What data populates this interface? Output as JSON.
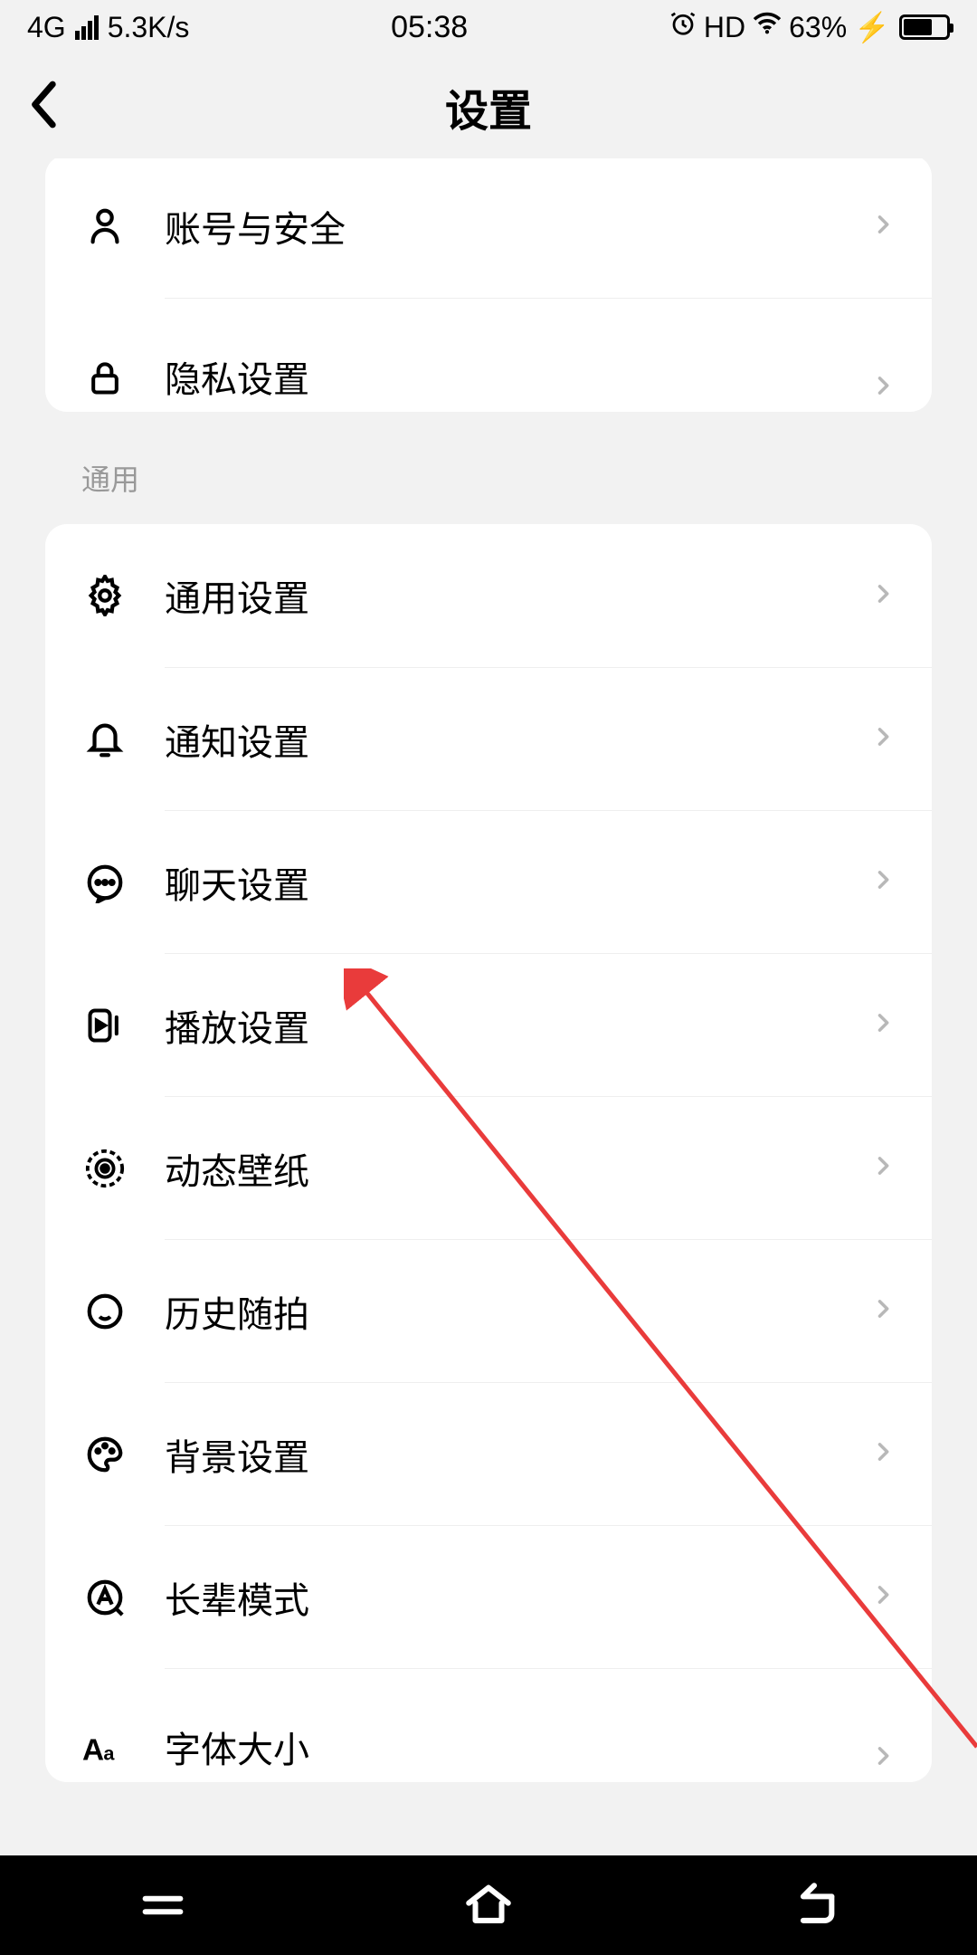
{
  "status": {
    "network": "4G",
    "speed": "5.3K/s",
    "time": "05:38",
    "hd": "HD",
    "battery_pct": "63%"
  },
  "header": {
    "title": "设置"
  },
  "group1": {
    "items": [
      {
        "label": "账号与安全",
        "icon": "user-icon"
      },
      {
        "label": "隐私设置",
        "icon": "lock-icon"
      }
    ]
  },
  "group2": {
    "title": "通用",
    "items": [
      {
        "label": "通用设置",
        "icon": "gear-icon"
      },
      {
        "label": "通知设置",
        "icon": "bell-icon"
      },
      {
        "label": "聊天设置",
        "icon": "chat-icon"
      },
      {
        "label": "播放设置",
        "icon": "play-icon"
      },
      {
        "label": "动态壁纸",
        "icon": "dynamic-wallpaper-icon"
      },
      {
        "label": "历史随拍",
        "icon": "history-icon"
      },
      {
        "label": "背景设置",
        "icon": "palette-icon"
      },
      {
        "label": "长辈模式",
        "icon": "a-circle-icon"
      },
      {
        "label": "字体大小",
        "icon": "font-size-icon"
      }
    ]
  }
}
